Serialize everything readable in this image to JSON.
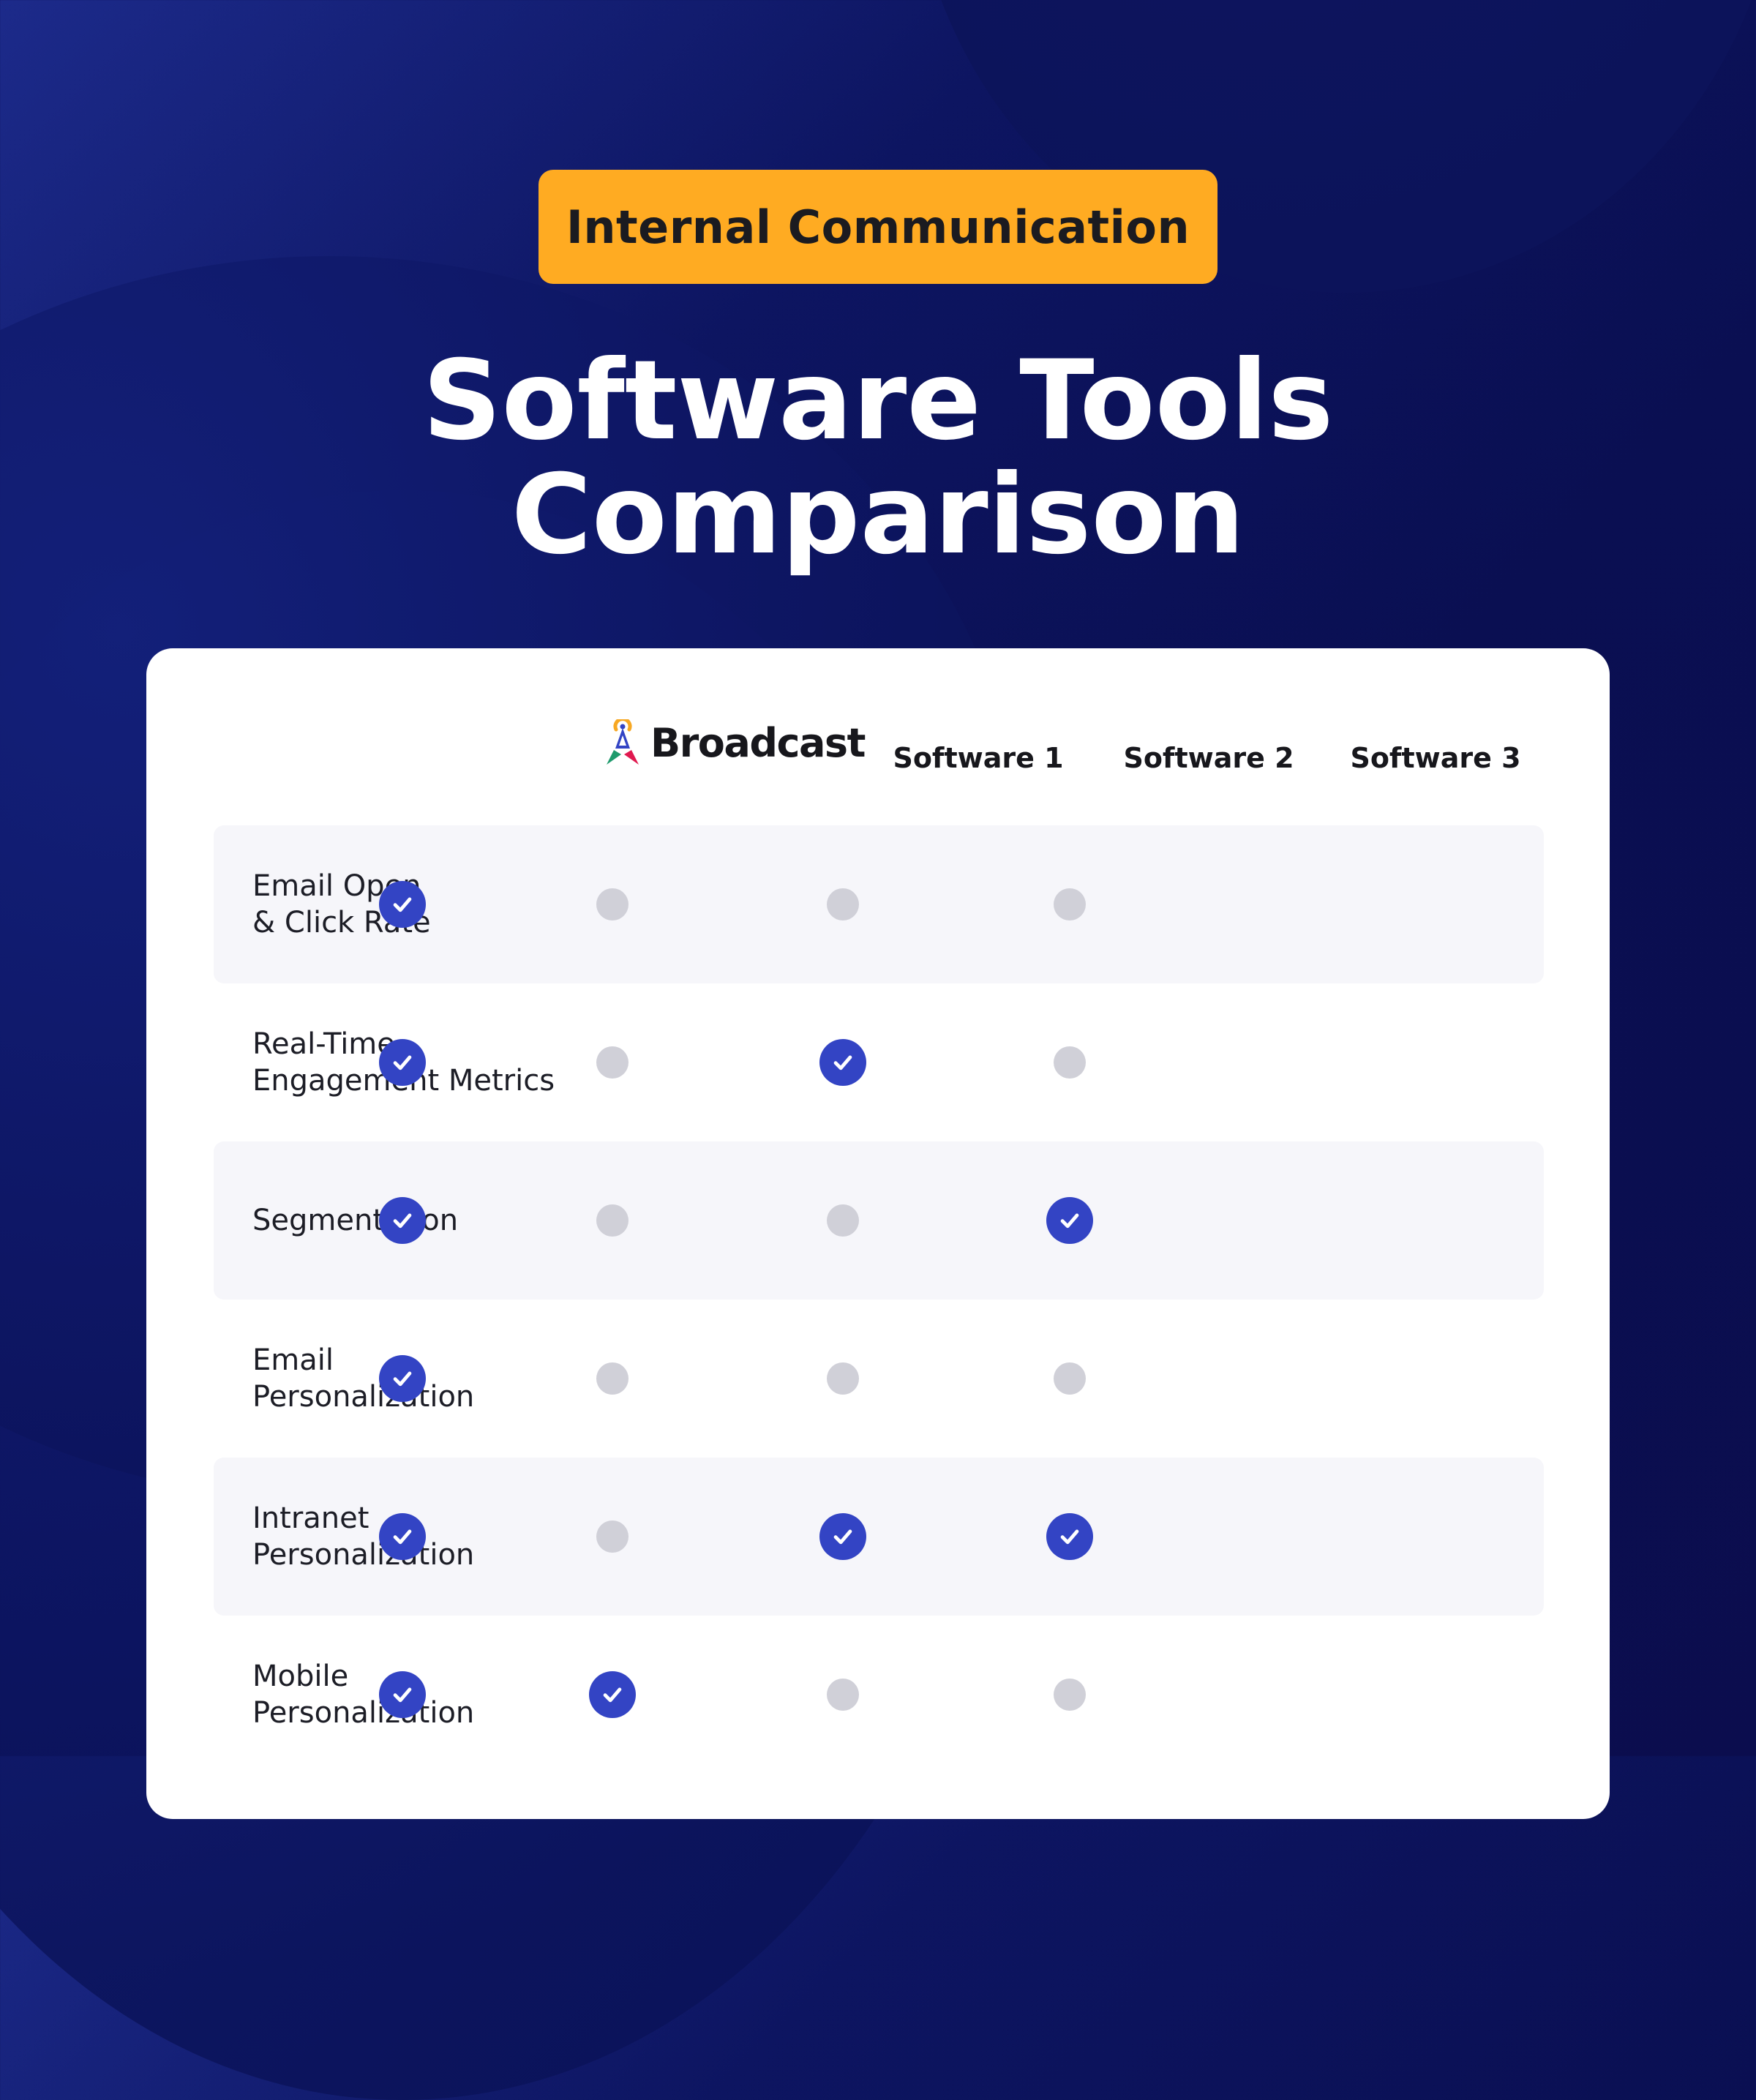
{
  "badge": {
    "label": "Internal Communication",
    "color": "#FFAB22"
  },
  "title": {
    "line1": "Software Tools",
    "line2": "Comparison"
  },
  "table": {
    "columns": [
      {
        "label": "Broadcast",
        "is_brand": true,
        "logo_icon": "broadcast-tower-logo-icon"
      },
      {
        "label": "Software 1"
      },
      {
        "label": "Software 2"
      },
      {
        "label": "Software 3"
      }
    ],
    "rows": [
      {
        "label_line1": "Email Open",
        "label_line2": "& Click Rate",
        "values": [
          true,
          false,
          false,
          false
        ]
      },
      {
        "label_line1": "Real-Time",
        "label_line2": "Engagement Metrics",
        "values": [
          true,
          false,
          true,
          false
        ]
      },
      {
        "label_line1": "Segmentation",
        "label_line2": "",
        "values": [
          true,
          false,
          false,
          true
        ]
      },
      {
        "label_line1": "Email",
        "label_line2": "Personalization",
        "values": [
          true,
          false,
          false,
          false
        ]
      },
      {
        "label_line1": "Intranet",
        "label_line2": "Personalization",
        "values": [
          true,
          false,
          true,
          true
        ]
      },
      {
        "label_line1": "Mobile",
        "label_line2": "Personalization",
        "values": [
          true,
          true,
          false,
          false
        ]
      }
    ],
    "icons": {
      "yes": "check-circle-icon",
      "no": "gray-dot-icon"
    },
    "colors": {
      "check": "#3344C4",
      "dot": "#D0D0D8",
      "row_shade": "#F6F6FA"
    }
  }
}
